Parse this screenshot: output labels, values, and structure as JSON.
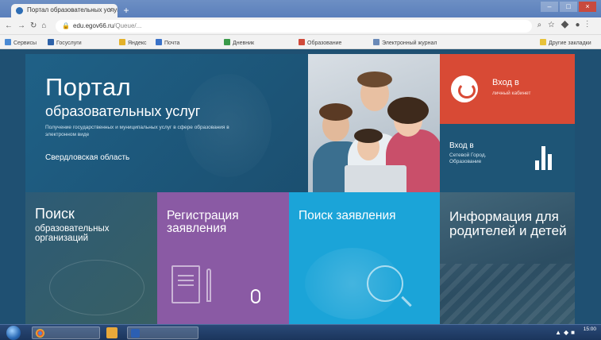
{
  "browser": {
    "tab_title": "Портал образовательных услуг",
    "tab_close": "×",
    "new_tab": "+",
    "url_host": "edu.egov66.ru",
    "url_rest": "/Queue/...",
    "bookmarks": [
      {
        "label": "Сервисы",
        "color": "#4a8ad4"
      },
      {
        "label": "Госуслуги",
        "color": "#2e62a8"
      },
      {
        "label": "Яндекс",
        "color": "#e4b12a"
      },
      {
        "label": "Почта",
        "color": "#3a72c8"
      },
      {
        "label": "Дневник",
        "color": "#3a9a4a"
      },
      {
        "label": "Образование",
        "color": "#d04a3a"
      },
      {
        "label": "Электронный журнал",
        "color": "#6a8ab8"
      },
      {
        "label": "Другие закладки",
        "color": "#e8c23a"
      }
    ]
  },
  "hero": {
    "title": "Портал",
    "subtitle": "образовательных услуг",
    "description": "Получение государственных и муниципальных услуг в сфере образования в электронном виде",
    "region": "Свердловская область"
  },
  "login_tile": {
    "title": "Вход в",
    "subtitle": "личный кабинет"
  },
  "netcity_tile": {
    "title": "Вход в",
    "subtitle": "Сетевой Город. Образование"
  },
  "tiles": {
    "search_org": {
      "title": "Поиск",
      "subtitle": "образовательных организаций"
    },
    "registration": {
      "title": "Регистрация заявления"
    },
    "search_app": {
      "title": "Поиск заявления"
    },
    "info": {
      "title": "Информация для родителей и детей"
    }
  },
  "colors": {
    "login_tile": "#d84a35",
    "registration_tile": "#8a5aa4",
    "search_app_tile": "#1ba4d8",
    "page_background": "#1e5576"
  }
}
